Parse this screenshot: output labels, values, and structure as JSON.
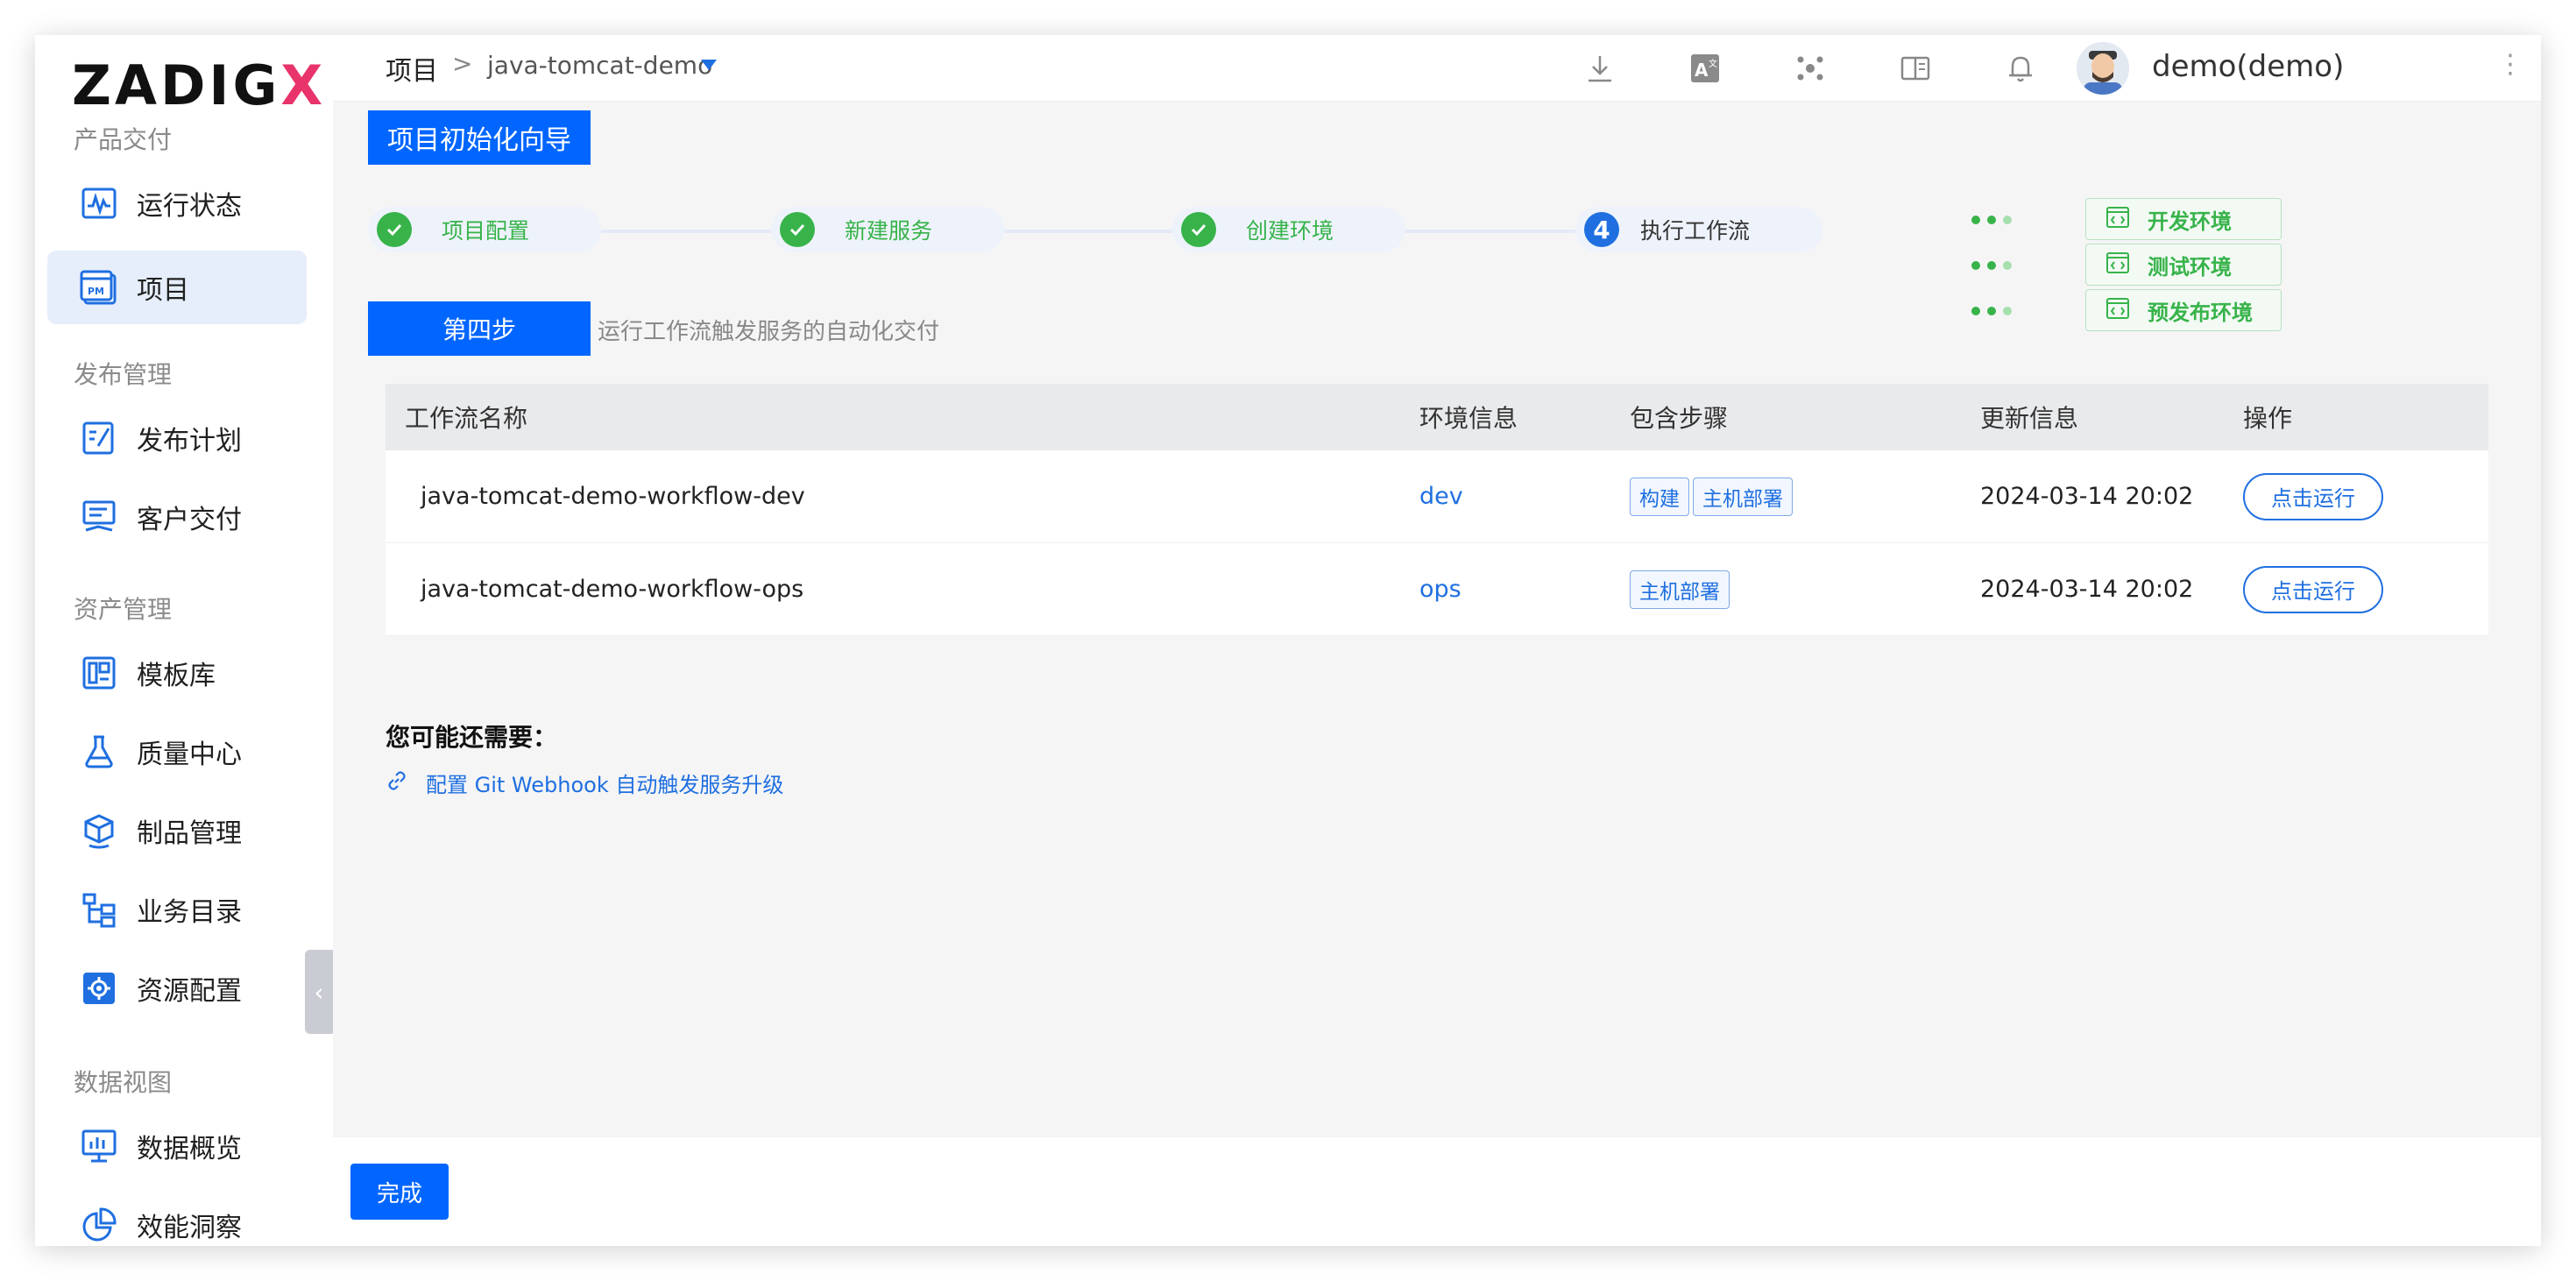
{
  "brand": {
    "logo_main": "ZADIG",
    "logo_x": "X"
  },
  "sidebar": {
    "sections": [
      {
        "title": "产品交付"
      },
      {
        "title": "发布管理"
      },
      {
        "title": "资产管理"
      },
      {
        "title": "数据视图"
      }
    ],
    "items": [
      {
        "label": "运行状态",
        "icon": "activity-monitor-icon"
      },
      {
        "label": "项目",
        "icon": "project-pm-icon",
        "active": true
      },
      {
        "label": "发布计划",
        "icon": "release-plan-icon"
      },
      {
        "label": "客户交付",
        "icon": "customer-delivery-icon"
      },
      {
        "label": "模板库",
        "icon": "template-library-icon"
      },
      {
        "label": "质量中心",
        "icon": "flask-icon"
      },
      {
        "label": "制品管理",
        "icon": "package-icon"
      },
      {
        "label": "业务目录",
        "icon": "catalog-tree-icon"
      },
      {
        "label": "资源配置",
        "icon": "gear-box-icon"
      },
      {
        "label": "数据概览",
        "icon": "chart-board-icon"
      },
      {
        "label": "效能洞察",
        "icon": "pie-chart-icon"
      }
    ],
    "collapse_glyph": "‹"
  },
  "header": {
    "crumb_root": "项目",
    "crumb_sep": ">",
    "crumb_project": "java-tomcat-demo",
    "user_name": "demo(demo)",
    "kebab": "⋮",
    "icons": [
      "download-icon",
      "translate-icon",
      "cluster-icon",
      "book-icon",
      "bell-icon"
    ]
  },
  "wizard": {
    "title": "项目初始化向导",
    "steps": [
      {
        "label": "项目配置",
        "done": true
      },
      {
        "label": "新建服务",
        "done": true
      },
      {
        "label": "创建环境",
        "done": true
      },
      {
        "label": "执行工作流",
        "done": false,
        "number": "4"
      }
    ],
    "envs": [
      {
        "label": "开发环境"
      },
      {
        "label": "测试环境"
      },
      {
        "label": "预发布环境"
      }
    ],
    "step_tag": "第四步",
    "step_desc": "运行工作流触发服务的自动化交付"
  },
  "table": {
    "headers": {
      "name": "工作流名称",
      "env": "环境信息",
      "steps": "包含步骤",
      "update": "更新信息",
      "ops": "操作"
    },
    "rows": [
      {
        "name": "java-tomcat-demo-workflow-dev",
        "env": "dev",
        "tags": [
          "构建",
          "主机部署"
        ],
        "update": "2024-03-14 20:02",
        "action": "点击运行"
      },
      {
        "name": "java-tomcat-demo-workflow-ops",
        "env": "ops",
        "tags": [
          "主机部署"
        ],
        "update": "2024-03-14 20:02",
        "action": "点击运行"
      }
    ]
  },
  "more": {
    "title": "您可能还需要：",
    "link": "配置 Git Webhook 自动触发服务升级"
  },
  "footer": {
    "done_label": "完成"
  }
}
